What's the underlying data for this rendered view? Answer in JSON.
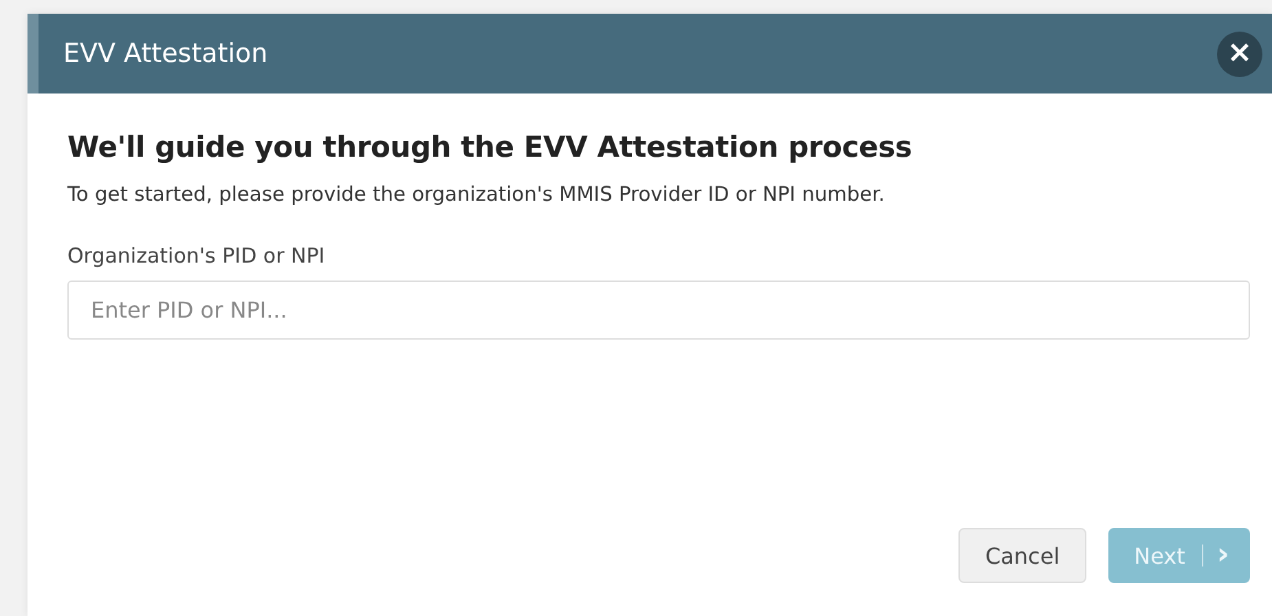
{
  "dialog": {
    "title": "EVV Attestation",
    "close": "×",
    "heading": "We'll guide you through the EVV Attestation process",
    "intro": "To get started, please provide the organization's MMIS Provider ID or NPI number.",
    "field": {
      "label": "Organization's PID or NPI",
      "placeholder": "Enter PID or NPI..."
    },
    "buttons": [
      {
        "kind": "secondary",
        "label": "Cancel",
        "disabled": false
      },
      {
        "kind": "primary",
        "label": "Next",
        "icon": "›",
        "disabled": true
      }
    ]
  }
}
